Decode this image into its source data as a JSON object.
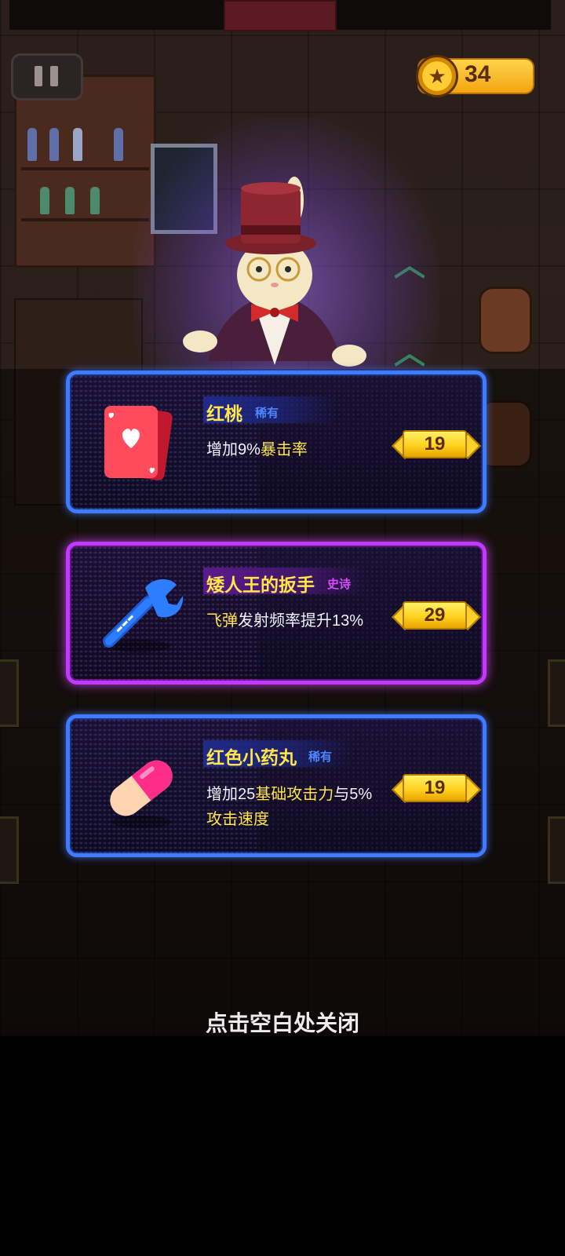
{
  "hud": {
    "coins": "34"
  },
  "items": [
    {
      "name": "红桃",
      "rarity": "稀有",
      "description_parts": [
        "增加9%",
        "暴击率",
        ""
      ],
      "price": "19",
      "icon": "heart-card-icon"
    },
    {
      "name": "矮人王的扳手",
      "rarity": "史诗",
      "description_parts": [
        "",
        "飞弹",
        "发射频率提升13%"
      ],
      "price": "29",
      "icon": "wrench-icon"
    },
    {
      "name": "红色小药丸",
      "rarity": "稀有",
      "description_parts": [
        "增加25",
        "基础攻击力",
        "与5%"
      ],
      "description_line2": "攻击速度",
      "price": "19",
      "icon": "pill-icon"
    }
  ],
  "close_hint": "点击空白处关闭",
  "colors": {
    "rare_border": "#3f7bff",
    "epic_border": "#c238ff",
    "highlight_text": "#ffe44a",
    "price_gold": "#ffd11f"
  }
}
